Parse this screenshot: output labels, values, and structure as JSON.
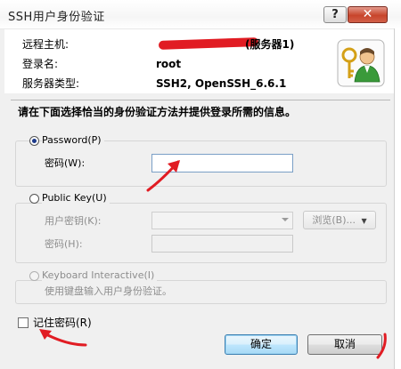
{
  "window": {
    "title": "SSH用户身份验证",
    "help_glyph": "?",
    "close_glyph": "✕"
  },
  "info": {
    "remote_host_label": "远程主机:",
    "remote_host_value": "(服务器1)",
    "login_label": "登录名:",
    "login_value": "root",
    "server_type_label": "服务器类型:",
    "server_type_value": "SSH2, OpenSSH_6.6.1",
    "icon": "user-key-icon"
  },
  "prompt": "请在下面选择恰当的身份验证方法并提供登录所需的信息。",
  "password_group": {
    "legend": "Password(P)",
    "selected": true,
    "field_label": "密码(W):",
    "value": ""
  },
  "publickey_group": {
    "legend": "Public Key(U)",
    "selected": false,
    "user_key_label": "用户密钥(K):",
    "user_key_value": "",
    "browse_label": "浏览(B)...",
    "passphrase_label": "密码(H):",
    "passphrase_value": ""
  },
  "keyboard_group": {
    "legend": "Keyboard Interactive(I)",
    "description": "使用键盘输入用户身份验证。",
    "enabled": false
  },
  "remember_password": {
    "label": "记住密码(R)",
    "checked": false
  },
  "buttons": {
    "ok": "确定",
    "cancel": "取消"
  },
  "colors": {
    "annotation_red": "#e11c23",
    "focus_blue": "#7a9fc6"
  }
}
